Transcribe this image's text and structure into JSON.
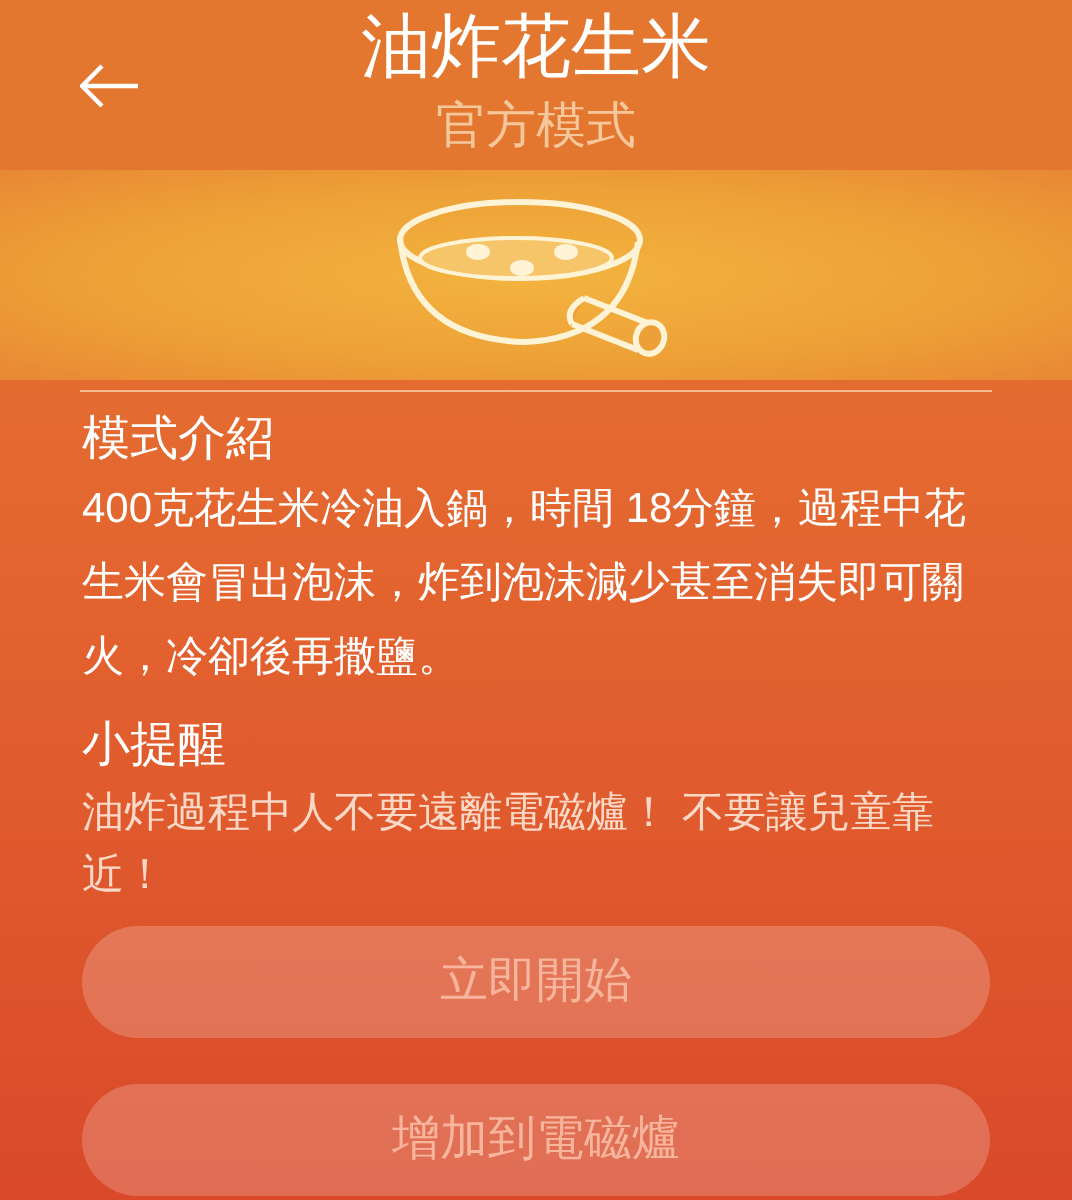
{
  "header": {
    "title": "油炸花生米",
    "subtitle": "官方模式"
  },
  "sections": [
    {
      "heading": "模式介紹",
      "text": "400克花生米冷油入鍋，時間 18分鐘，過程中花生米會冒出泡沫，炸到泡沫減少甚至消失即可關火，冷卻後再撒鹽。"
    },
    {
      "heading": "小提醒",
      "text": "油炸過程中人不要遠離電磁爐！ 不要讓兒童靠近！"
    }
  ],
  "buttons": [
    {
      "label": "立即開始",
      "disabled": true
    },
    {
      "label": "增加到電磁爐",
      "disabled": true
    }
  ]
}
